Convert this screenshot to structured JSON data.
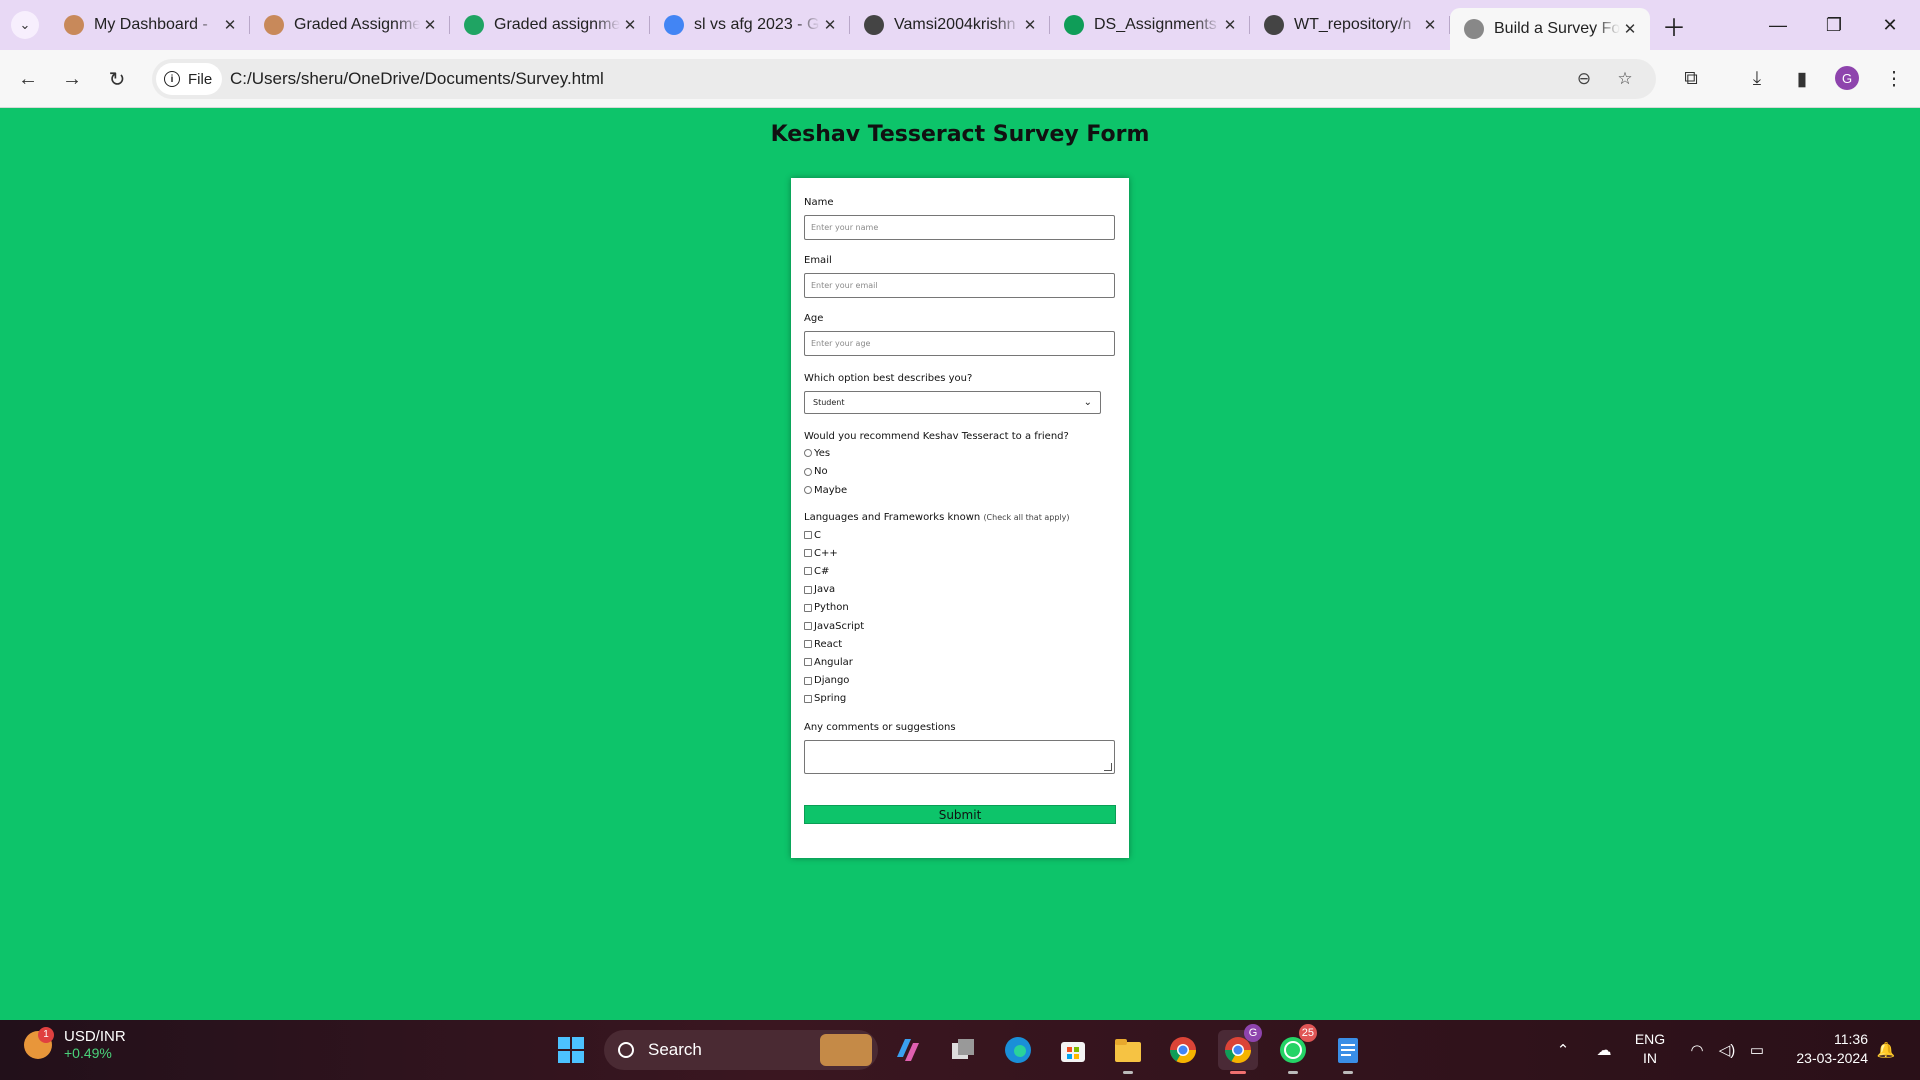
{
  "browser": {
    "tabs": [
      {
        "title": "My Dashboard -",
        "favicon": "moodle-icon",
        "color": "#c8895a"
      },
      {
        "title": "Graded Assignme",
        "favicon": "moodle-icon",
        "color": "#c8895a"
      },
      {
        "title": "Graded assignme",
        "favicon": "google-drive-icon",
        "color": "#1fa463"
      },
      {
        "title": "sl vs afg 2023 - G",
        "favicon": "google-icon",
        "color": "#4285f4"
      },
      {
        "title": "Vamsi2004krishn",
        "favicon": "github-icon",
        "color": "#444444"
      },
      {
        "title": "DS_Assignments",
        "favicon": "google-sheets-icon",
        "color": "#0f9d58"
      },
      {
        "title": "WT_repository/n",
        "favicon": "github-icon",
        "color": "#444444"
      },
      {
        "title": "Build a Survey Fo",
        "favicon": "globe-icon",
        "color": "#888888",
        "active": true
      }
    ],
    "address_chip": "File",
    "url": "C:/Users/sheru/OneDrive/Documents/Survey.html",
    "profile_initial": "G"
  },
  "page": {
    "background": "#0dc46a",
    "title": "Keshav Tesseract Survey Form",
    "name_label": "Name",
    "name_placeholder": "Enter your name",
    "email_label": "Email",
    "email_placeholder": "Enter your email",
    "age_label": "Age",
    "age_placeholder": "Enter your age",
    "role_label": "Which option best describes you?",
    "role_selected": "Student",
    "recommend_label": "Would you recommend Keshav Tesseract to a friend?",
    "recommend_options": [
      "Yes",
      "No",
      "Maybe"
    ],
    "languages_label": "Languages and Frameworks known",
    "languages_hint": "(Check all that apply)",
    "languages": [
      "C",
      "C++",
      "C#",
      "Java",
      "Python",
      "JavaScript",
      "React",
      "Angular",
      "Django",
      "Spring"
    ],
    "comments_label": "Any comments or suggestions",
    "submit_label": "Submit"
  },
  "taskbar": {
    "stock_name": "USD/INR",
    "stock_change": "+0.49%",
    "stock_badge": "1",
    "search_label": "Search",
    "chrome_profile_badge": "G",
    "whatsapp_badge": "25",
    "lang_line1": "ENG",
    "lang_line2": "IN",
    "time": "11:36",
    "date": "23-03-2024"
  }
}
